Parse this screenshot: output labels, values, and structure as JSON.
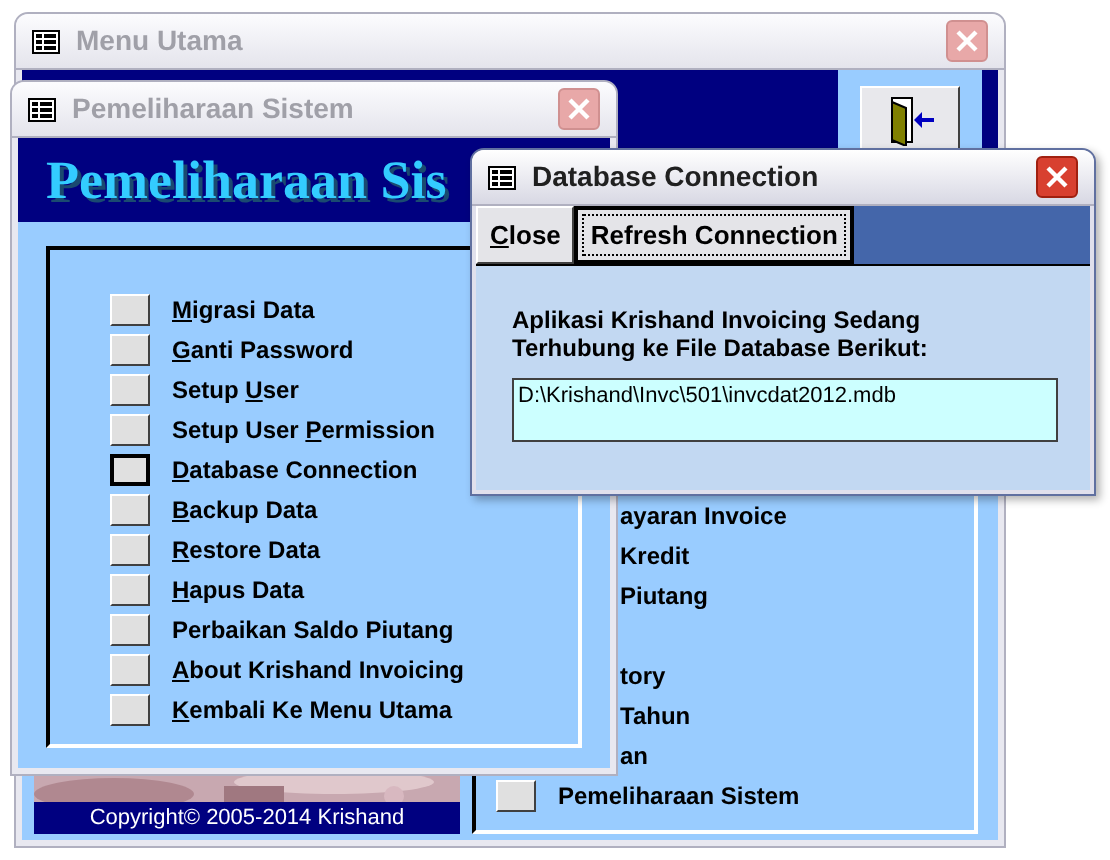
{
  "main_window": {
    "title": "Menu Utama",
    "active": false,
    "menu_items": [
      {
        "kind": "text",
        "label": "ayaran Invoice"
      },
      {
        "kind": "text",
        "label": "Kredit"
      },
      {
        "kind": "text",
        "label": "Piutang"
      },
      {
        "kind": "blank"
      },
      {
        "kind": "text",
        "label": "tory"
      },
      {
        "kind": "text",
        "label": "Tahun"
      },
      {
        "kind": "text",
        "label": "an"
      },
      {
        "kind": "button",
        "label": "Pemeliharaan Sistem",
        "selected": false
      }
    ],
    "copyright": "Copyright© 2005-2014 Krishand"
  },
  "maintenance_window": {
    "title": "Pemeliharaan Sistem",
    "active": false,
    "heading": "Pemeliharaan Sis",
    "menu_items": [
      {
        "label_parts": [
          {
            "text": "M",
            "underlined": true
          },
          {
            "text": "igrasi Data",
            "underlined": false
          }
        ],
        "selected": false
      },
      {
        "label_parts": [
          {
            "text": "G",
            "underlined": true
          },
          {
            "text": "anti Password",
            "underlined": false
          }
        ],
        "selected": false
      },
      {
        "label_parts": [
          {
            "text": "Setup ",
            "underlined": false
          },
          {
            "text": "U",
            "underlined": true
          },
          {
            "text": "ser",
            "underlined": false
          }
        ],
        "selected": false
      },
      {
        "label_parts": [
          {
            "text": "Setup User ",
            "underlined": false
          },
          {
            "text": "P",
            "underlined": true
          },
          {
            "text": "ermission",
            "underlined": false
          }
        ],
        "selected": false
      },
      {
        "label_parts": [
          {
            "text": "D",
            "underlined": true
          },
          {
            "text": "atabase Connection",
            "underlined": false
          }
        ],
        "selected": true
      },
      {
        "label_parts": [
          {
            "text": "B",
            "underlined": true
          },
          {
            "text": "ackup Data",
            "underlined": false
          }
        ],
        "selected": false
      },
      {
        "label_parts": [
          {
            "text": "R",
            "underlined": true
          },
          {
            "text": "estore Data",
            "underlined": false
          }
        ],
        "selected": false
      },
      {
        "label_parts": [
          {
            "text": "H",
            "underlined": true
          },
          {
            "text": "apus Data",
            "underlined": false
          }
        ],
        "selected": false
      },
      {
        "label_parts": [
          {
            "text": "Perbaikan Saldo Piutang",
            "underlined": false
          }
        ],
        "selected": false
      },
      {
        "label_parts": [
          {
            "text": "A",
            "underlined": true
          },
          {
            "text": "bout Krishand Invoicing",
            "underlined": false
          }
        ],
        "selected": false
      },
      {
        "label_parts": [
          {
            "text": "K",
            "underlined": true
          },
          {
            "text": "embali Ke Menu Utama",
            "underlined": false
          }
        ],
        "selected": false
      }
    ]
  },
  "dialog": {
    "title": "Database Connection",
    "active": true,
    "buttons": [
      {
        "label_parts": [
          {
            "text": "C",
            "underlined": true
          },
          {
            "text": "lose",
            "underlined": false
          }
        ],
        "selected": false
      },
      {
        "label_parts": [
          {
            "text": "Refresh Connection",
            "underlined": false
          }
        ],
        "selected": true
      }
    ],
    "message": "Aplikasi Krishand Invoicing Sedang Terhubung ke File Database Berikut:",
    "path": "D:\\Krishand\\Invc\\501\\invcdat2012.mdb"
  }
}
